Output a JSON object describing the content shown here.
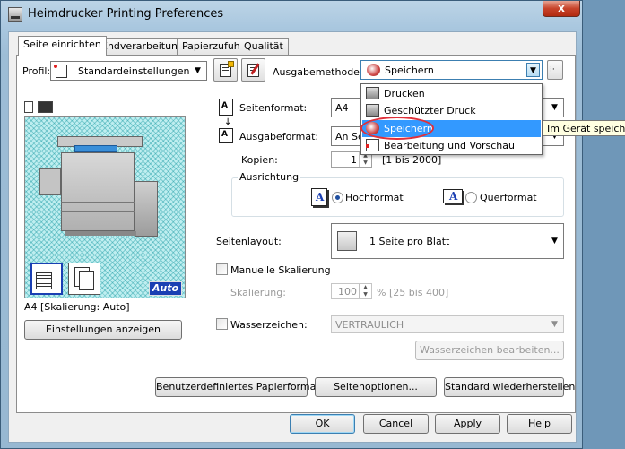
{
  "window": {
    "title": "Heimdrucker Printing Preferences",
    "close_glyph": "x"
  },
  "tabs": [
    {
      "label": "Seite einrichten"
    },
    {
      "label": "Endverarbeitung"
    },
    {
      "label": "Papierzufuhr"
    },
    {
      "label": "Qualität"
    }
  ],
  "profile": {
    "label": "Profil:",
    "value": "Standardeinstellungen"
  },
  "output_method": {
    "label": "Ausgabemethode:",
    "value": "Speichern"
  },
  "output_options": [
    {
      "label": "Drucken",
      "icon": "printer-icon"
    },
    {
      "label": "Geschützter Druck",
      "icon": "lock-icon"
    },
    {
      "label": "Speichern",
      "icon": "save-icon",
      "selected": true
    },
    {
      "label": "Bearbeitung und Vorschau",
      "icon": "edit-preview-icon"
    }
  ],
  "tooltip": "Im Gerät speichern",
  "page_format": {
    "label": "Seitenformat:",
    "value": "A4"
  },
  "output_format": {
    "label": "Ausgabeformat:",
    "value": "An Se"
  },
  "copies": {
    "label": "Kopien:",
    "value": "1",
    "range": "[1 bis 2000]"
  },
  "orientation": {
    "title": "Ausrichtung",
    "portrait": "Hochformat",
    "landscape": "Querformat",
    "selected": "portrait"
  },
  "page_layout": {
    "label": "Seitenlayout:",
    "value": "1 Seite pro Blatt"
  },
  "manual_scaling": {
    "label": "Manuelle Skalierung",
    "checked": false
  },
  "scaling": {
    "label": "Skalierung:",
    "value": "100",
    "range": "% [25 bis 400]"
  },
  "watermark": {
    "label": "Wasserzeichen:",
    "value": "VERTRAULICH",
    "checked": false,
    "edit_button": "Wasserzeichen bearbeiten..."
  },
  "preview": {
    "status": "A4 [Skalierung: Auto]",
    "auto_badge": "Auto",
    "show_settings_button": "Einstellungen anzeigen"
  },
  "bottom_buttons": {
    "custom_paper": "Benutzerdefiniertes Papierformat...",
    "page_options": "Seitenoptionen...",
    "restore_defaults": "Standard wiederherstellen"
  },
  "dialog_buttons": {
    "ok": "OK",
    "cancel": "Cancel",
    "apply": "Apply",
    "help": "Help"
  },
  "colors": {
    "selection": "#3399ff",
    "highlight_ring": "#e0303a",
    "preview_bg": "#bfeef0",
    "auto_badge": "#1a3fb3"
  }
}
